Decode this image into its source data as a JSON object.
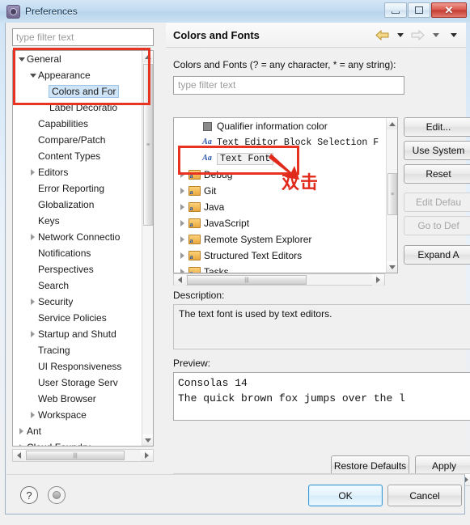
{
  "window": {
    "title": "Preferences",
    "icon": "preferences-gear-icon",
    "minimize_label": "",
    "maximize_label": "",
    "close_label": "✕"
  },
  "sidebar": {
    "filter_placeholder": "type filter text",
    "filter_value": "",
    "items": [
      {
        "label": "General",
        "indent": 0,
        "twisty": "down",
        "selected": false
      },
      {
        "label": "Appearance",
        "indent": 1,
        "twisty": "down",
        "selected": false
      },
      {
        "label": "Colors and For",
        "indent": 2,
        "twisty": "none",
        "selected": true
      },
      {
        "label": "Label Decoratio",
        "indent": 2,
        "twisty": "none",
        "selected": false
      },
      {
        "label": "Capabilities",
        "indent": 1,
        "twisty": "none",
        "selected": false
      },
      {
        "label": "Compare/Patch",
        "indent": 1,
        "twisty": "none",
        "selected": false
      },
      {
        "label": "Content Types",
        "indent": 1,
        "twisty": "none",
        "selected": false
      },
      {
        "label": "Editors",
        "indent": 1,
        "twisty": "right",
        "selected": false
      },
      {
        "label": "Error Reporting",
        "indent": 1,
        "twisty": "none",
        "selected": false
      },
      {
        "label": "Globalization",
        "indent": 1,
        "twisty": "none",
        "selected": false
      },
      {
        "label": "Keys",
        "indent": 1,
        "twisty": "none",
        "selected": false
      },
      {
        "label": "Network Connectio",
        "indent": 1,
        "twisty": "right",
        "selected": false
      },
      {
        "label": "Notifications",
        "indent": 1,
        "twisty": "none",
        "selected": false
      },
      {
        "label": "Perspectives",
        "indent": 1,
        "twisty": "none",
        "selected": false
      },
      {
        "label": "Search",
        "indent": 1,
        "twisty": "none",
        "selected": false
      },
      {
        "label": "Security",
        "indent": 1,
        "twisty": "right",
        "selected": false
      },
      {
        "label": "Service Policies",
        "indent": 1,
        "twisty": "none",
        "selected": false
      },
      {
        "label": "Startup and Shutd",
        "indent": 1,
        "twisty": "right",
        "selected": false
      },
      {
        "label": "Tracing",
        "indent": 1,
        "twisty": "none",
        "selected": false
      },
      {
        "label": "UI Responsiveness",
        "indent": 1,
        "twisty": "none",
        "selected": false
      },
      {
        "label": "User Storage Serv",
        "indent": 1,
        "twisty": "none",
        "selected": false
      },
      {
        "label": "Web Browser",
        "indent": 1,
        "twisty": "none",
        "selected": false
      },
      {
        "label": "Workspace",
        "indent": 1,
        "twisty": "right",
        "selected": false
      },
      {
        "label": "Ant",
        "indent": 0,
        "twisty": "right",
        "selected": false
      },
      {
        "label": "Cloud Foundry",
        "indent": 0,
        "twisty": "right",
        "selected": false
      }
    ]
  },
  "page": {
    "title": "Colors and Fonts",
    "nav_back_icon": "arrow-left-icon",
    "nav_forward_icon": "arrow-right-icon",
    "nav_menu_icon": "chevron-down-icon",
    "filter_label": "Colors and Fonts (? = any character, * = any string):",
    "filter_placeholder": "type filter text",
    "filter_value": "",
    "tree": [
      {
        "label": "Qualifier information color",
        "indent": 1,
        "twisty": "none",
        "icon": "color-swatch",
        "mono": false,
        "selected": false
      },
      {
        "label": "Text Editor Block Selection F",
        "indent": 1,
        "twisty": "none",
        "icon": "font-aa",
        "mono": true,
        "selected": false
      },
      {
        "label": "Text Font",
        "indent": 1,
        "twisty": "none",
        "icon": "font-aa",
        "mono": true,
        "selected": true
      },
      {
        "label": "Debug",
        "indent": 0,
        "twisty": "right",
        "icon": "category-folder",
        "mono": false,
        "selected": false
      },
      {
        "label": "Git",
        "indent": 0,
        "twisty": "right",
        "icon": "category-folder",
        "mono": false,
        "selected": false
      },
      {
        "label": "Java",
        "indent": 0,
        "twisty": "right",
        "icon": "category-folder",
        "mono": false,
        "selected": false
      },
      {
        "label": "JavaScript",
        "indent": 0,
        "twisty": "right",
        "icon": "category-folder",
        "mono": false,
        "selected": false
      },
      {
        "label": "Remote System Explorer",
        "indent": 0,
        "twisty": "right",
        "icon": "category-folder",
        "mono": false,
        "selected": false
      },
      {
        "label": "Structured Text Editors",
        "indent": 0,
        "twisty": "right",
        "icon": "category-folder",
        "mono": false,
        "selected": false
      },
      {
        "label": "Tasks",
        "indent": 0,
        "twisty": "right",
        "icon": "category-folder",
        "mono": false,
        "selected": false
      }
    ],
    "buttons": [
      {
        "label": "Edit...",
        "enabled": true
      },
      {
        "label": "Use System",
        "enabled": true
      },
      {
        "label": "Reset",
        "enabled": true
      },
      {
        "label": "Edit Defau",
        "enabled": false
      },
      {
        "label": "Go to Def",
        "enabled": false
      },
      {
        "label": "Expand A",
        "enabled": true
      }
    ],
    "description_label": "Description:",
    "description_text": "The text font is used by text editors.",
    "preview_label": "Preview:",
    "preview_line1": "Consolas 14",
    "preview_line2": "The quick brown fox jumps over the l",
    "restore_defaults_label": "Restore Defaults",
    "apply_label": "Apply"
  },
  "footer": {
    "help_icon": "question-mark-icon",
    "tray_icon": "tray-circle-icon",
    "ok_label": "OK",
    "cancel_label": "Cancel"
  },
  "annotations": {
    "double_click_text": "双击",
    "highlight_color": "#e83323"
  }
}
